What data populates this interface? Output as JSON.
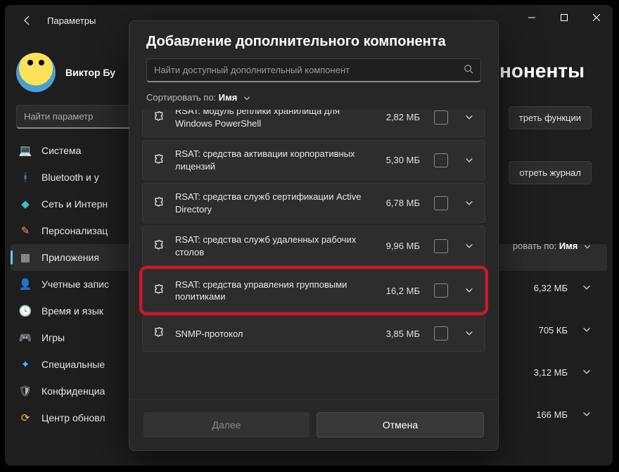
{
  "window": {
    "title": "Параметры"
  },
  "profile": {
    "name": "Виктор Бу",
    "sub": ""
  },
  "search": {
    "placeholder": "Найти параметр"
  },
  "sidebar": {
    "items": [
      {
        "label": "Система",
        "icon": "💻",
        "color": "#4fb6ff"
      },
      {
        "label": "Bluetooth и у",
        "icon": "ᚼ",
        "color": "#4fb6ff"
      },
      {
        "label": "Сеть и Интерн",
        "icon": "◆",
        "color": "#35c3c3"
      },
      {
        "label": "Персонализац",
        "icon": "✎",
        "color": "#ff9a5a"
      },
      {
        "label": "Приложения",
        "icon": "▦",
        "color": "#b8b8b8"
      },
      {
        "label": "Учетные запис",
        "icon": "👤",
        "color": "#3fc97a"
      },
      {
        "label": "Время и язык",
        "icon": "🕓",
        "color": "#ff9a3c"
      },
      {
        "label": "Игры",
        "icon": "🎮",
        "color": "#d35bc8"
      },
      {
        "label": "Специальные",
        "icon": "✦",
        "color": "#4fb6ff"
      },
      {
        "label": "Конфиденциа",
        "icon": "🛡",
        "color": "#b8b8b8"
      },
      {
        "label": "Центр обновл",
        "icon": "⟳",
        "color": "#ffb34f"
      }
    ],
    "activeIndex": 4
  },
  "main": {
    "title": "ноненты",
    "btn1": "треть функции",
    "btn2": "отреть журнал",
    "sort_prefix": "ровать по:",
    "sort_value": "Имя",
    "rows": [
      {
        "size": "6,32 МБ"
      },
      {
        "size": "705 КБ"
      },
      {
        "size": "3,12 МБ"
      },
      {
        "size": "166 МБ"
      }
    ]
  },
  "dialog": {
    "title": "Добавление дополнительного компонента",
    "search_placeholder": "Найти доступный дополнительный компонент",
    "sort_prefix": "Сортировать по:",
    "sort_value": "Имя",
    "features": [
      {
        "name": "RSAT: модуль реплики хранилища для Windows PowerShell",
        "size": "2,82 МБ",
        "cut": true
      },
      {
        "name": "RSAT: средства активации корпоративных лицензий",
        "size": "5,30 МБ"
      },
      {
        "name": "RSAT: средства служб сертификации Active Directory",
        "size": "6,78 МБ"
      },
      {
        "name": "RSAT: средства служб удаленных рабочих столов",
        "size": "9,96 МБ"
      },
      {
        "name": "RSAT: средства управления групповыми политиками",
        "size": "16,2 МБ",
        "highlight": true
      },
      {
        "name": "SNMP-протокол",
        "size": "3,85 МБ"
      }
    ],
    "next": "Далее",
    "cancel": "Отмена"
  }
}
